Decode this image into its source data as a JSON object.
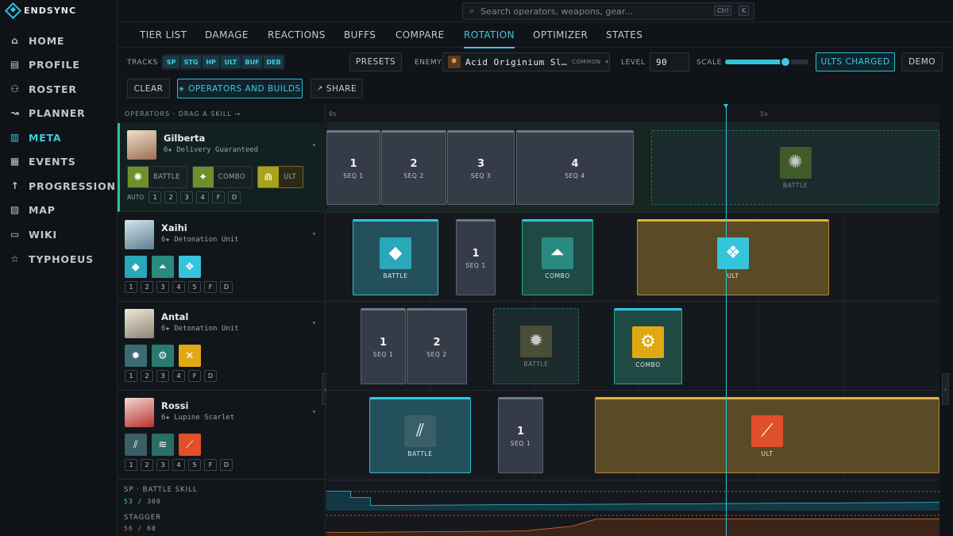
{
  "app": {
    "name": "ENDSYNC"
  },
  "search": {
    "placeholder": "Search operators, weapons, gear...",
    "shortcut_ctrl": "Ctrl",
    "shortcut_key": "K"
  },
  "nav": [
    {
      "label": "HOME",
      "icon": "home-icon"
    },
    {
      "label": "PROFILE",
      "icon": "profile-card-icon"
    },
    {
      "label": "ROSTER",
      "icon": "users-icon"
    },
    {
      "label": "PLANNER",
      "icon": "route-icon"
    },
    {
      "label": "META",
      "icon": "bar-chart-icon",
      "active": true
    },
    {
      "label": "EVENTS",
      "icon": "calendar-icon"
    },
    {
      "label": "PROGRESSION",
      "icon": "arrow-up-icon"
    },
    {
      "label": "MAP",
      "icon": "map-icon"
    },
    {
      "label": "WIKI",
      "icon": "book-icon"
    },
    {
      "label": "TYPHOEUS",
      "icon": "star-icon"
    }
  ],
  "tabs": [
    "TIER LIST",
    "DAMAGE",
    "REACTIONS",
    "BUFFS",
    "COMPARE",
    "ROTATION",
    "OPTIMIZER",
    "STATES"
  ],
  "active_tab": "ROTATION",
  "controls": {
    "tracks_label": "TRACKS",
    "tracks": [
      "SP",
      "STG",
      "HP",
      "ULT",
      "BUF",
      "DEB"
    ],
    "presets": "PRESETS",
    "enemy_label": "ENEMY",
    "enemy_name": "Acid Originium Sl…",
    "enemy_tier": "COMMON",
    "level_label": "LEVEL",
    "level_value": "90",
    "scale_label": "SCALE",
    "scale_value": 0.72,
    "ults_charged": "ULTS CHARGED",
    "demo": "DEMO",
    "clear": "CLEAR",
    "operators_builds": "OPERATORS AND BUILDS",
    "share": "SHARE"
  },
  "operators_header": "OPERATORS · DRAG A SKILL →",
  "operators": [
    {
      "name": "Gilberta",
      "sub": "6★ Delivery Guaranteed",
      "chev": "▴",
      "skills": [
        {
          "label": "BATTLE"
        },
        {
          "label": "COMBO"
        },
        {
          "label": "ULT"
        }
      ],
      "auto": "AUTO",
      "seq": [
        "1",
        "2",
        "3",
        "4",
        "F",
        "D"
      ]
    },
    {
      "name": "Xaihi",
      "sub": "6★ Detonation Unit",
      "chev": "▾",
      "seq": [
        "1",
        "2",
        "3",
        "4",
        "5",
        "F",
        "D"
      ]
    },
    {
      "name": "Antal",
      "sub": "6★ Detonation Unit",
      "chev": "▾",
      "seq": [
        "1",
        "2",
        "3",
        "4",
        "F",
        "D"
      ]
    },
    {
      "name": "Rossi",
      "sub": "6★ Lupine Scarlet",
      "chev": "▾",
      "seq": [
        "1",
        "2",
        "3",
        "4",
        "5",
        "F",
        "D"
      ]
    }
  ],
  "resources": {
    "sp_label": "SP · BATTLE SKILL",
    "sp_value": "53",
    "sp_max": "300",
    "stagger_label": "STAGGER",
    "stagger_value": "56",
    "stagger_max": "60"
  },
  "timeline": {
    "ticks": [
      "0s",
      "5s"
    ],
    "lanes": [
      [
        {
          "kind": "seq",
          "n": "1",
          "label": "SEQ 1"
        },
        {
          "kind": "seq",
          "n": "2",
          "label": "SEQ 2"
        },
        {
          "kind": "seq",
          "n": "3",
          "label": "SEQ 3"
        },
        {
          "kind": "seq",
          "n": "4",
          "label": "SEQ 4"
        },
        {
          "kind": "ghost",
          "label": "BATTLE"
        }
      ],
      [
        {
          "kind": "bat",
          "label": "BATTLE"
        },
        {
          "kind": "seq",
          "n": "1",
          "label": "SEQ 1"
        },
        {
          "kind": "cmb",
          "label": "COMBO"
        },
        {
          "kind": "ult",
          "label": "ULT"
        }
      ],
      [
        {
          "kind": "seq",
          "n": "1",
          "label": "SEQ 1"
        },
        {
          "kind": "seq",
          "n": "2",
          "label": "SEQ 2"
        },
        {
          "kind": "ghost",
          "label": "BATTLE"
        },
        {
          "kind": "cmb",
          "label": "COMBO"
        }
      ],
      [
        {
          "kind": "bat",
          "label": "BATTLE"
        },
        {
          "kind": "seq",
          "n": "1",
          "label": "SEQ 1"
        },
        {
          "kind": "ult",
          "label": "ULT"
        }
      ]
    ]
  }
}
